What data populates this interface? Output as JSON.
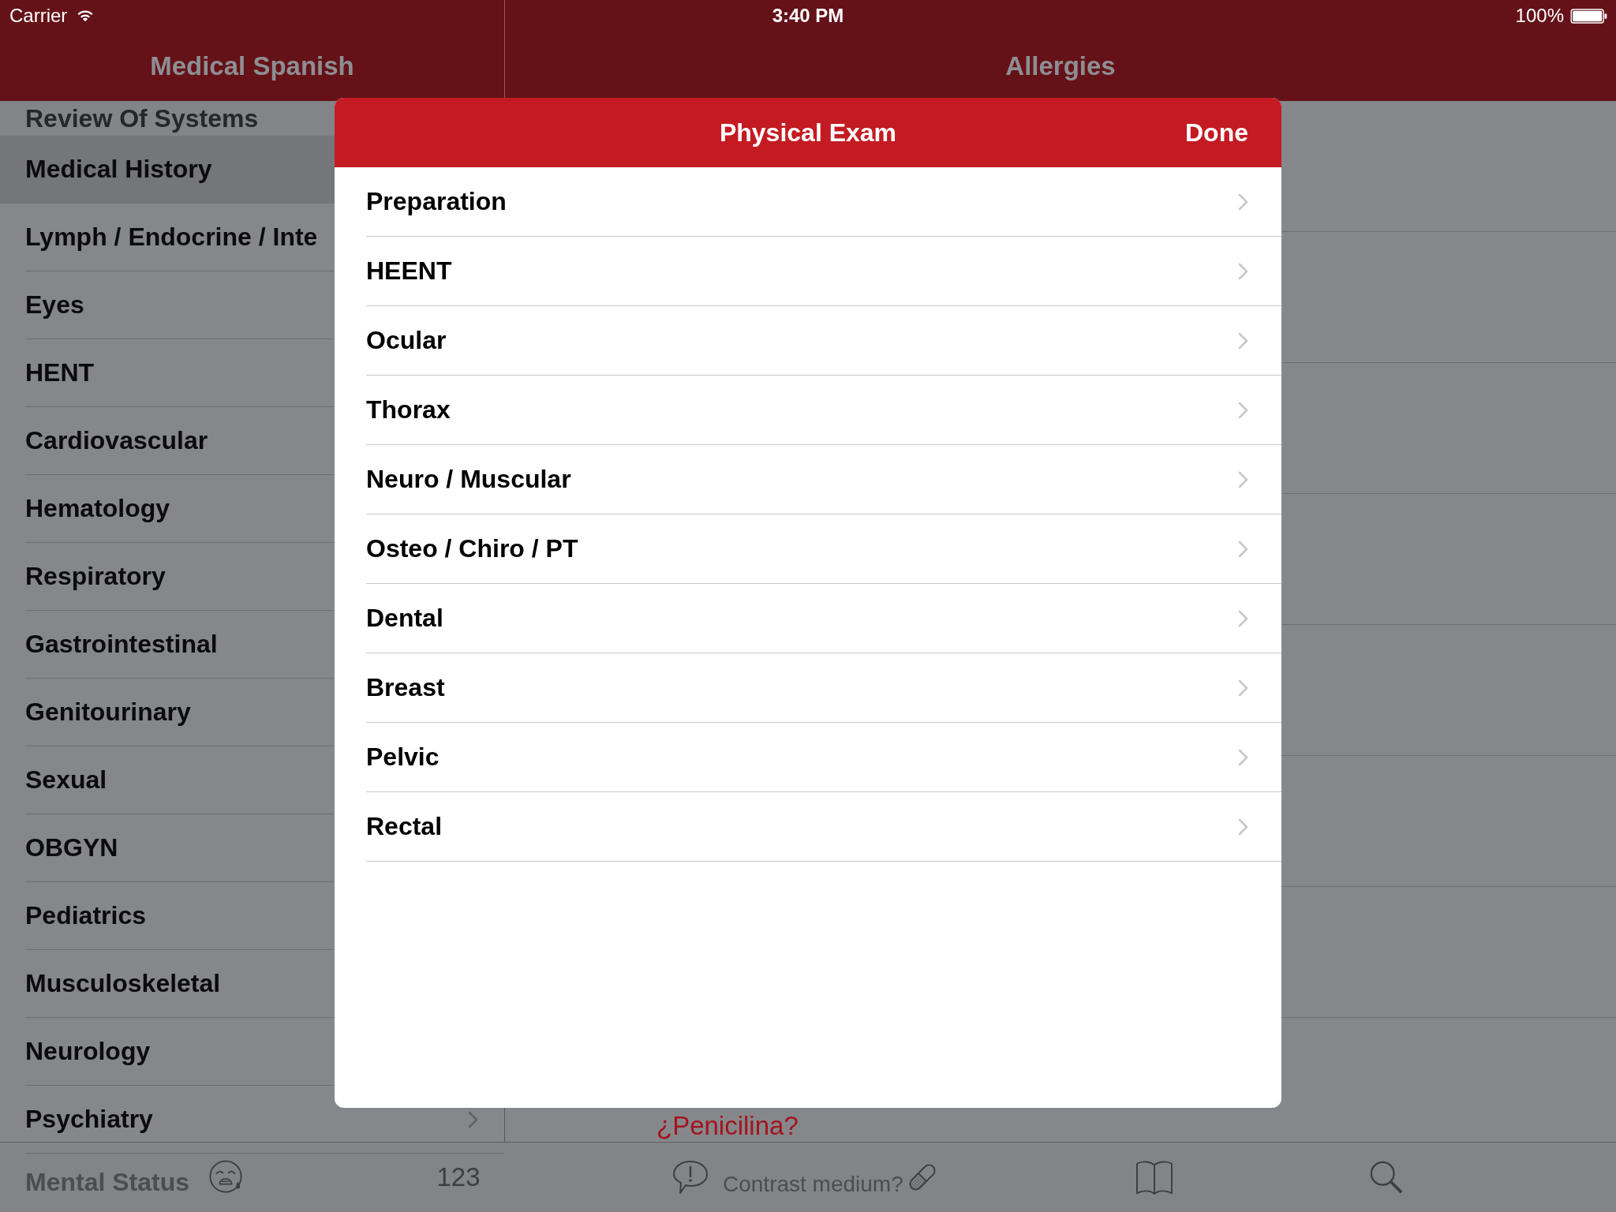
{
  "status_bar": {
    "carrier": "Carrier",
    "time": "3:40 PM",
    "battery": "100%"
  },
  "nav_bar": {
    "master_title": "Medical Spanish",
    "detail_title": "Allergies"
  },
  "sidebar": {
    "section": "Review Of Systems",
    "items": [
      {
        "label": "Medical History",
        "selected": true
      },
      {
        "label": "Lymph / Endocrine / Inte",
        "selected": false
      },
      {
        "label": "Eyes",
        "selected": false
      },
      {
        "label": "HENT",
        "selected": false
      },
      {
        "label": "Cardiovascular",
        "selected": false
      },
      {
        "label": "Hematology",
        "selected": false
      },
      {
        "label": "Respiratory",
        "selected": false
      },
      {
        "label": "Gastrointestinal",
        "selected": false
      },
      {
        "label": "Genitourinary",
        "selected": false
      },
      {
        "label": "Sexual",
        "selected": false
      },
      {
        "label": "OBGYN",
        "selected": false
      },
      {
        "label": "Pediatrics",
        "selected": false
      },
      {
        "label": "Musculoskeletal",
        "selected": false
      },
      {
        "label": "Neurology",
        "selected": false
      },
      {
        "label": "Psychiatry",
        "selected": false,
        "chevron": true
      },
      {
        "label": "Mental Status",
        "selected": false
      }
    ]
  },
  "detail": {
    "rows": [
      {
        "kind": "spanish",
        "text": "¿Penicilina?"
      },
      {
        "kind": "english",
        "text": "Contrast medium?"
      }
    ]
  },
  "modal": {
    "title": "Physical Exam",
    "done": "Done",
    "items": [
      {
        "label": "Preparation"
      },
      {
        "label": "HEENT"
      },
      {
        "label": "Ocular"
      },
      {
        "label": "Thorax"
      },
      {
        "label": "Neuro / Muscular"
      },
      {
        "label": "Osteo / Chiro / PT"
      },
      {
        "label": "Dental"
      },
      {
        "label": "Breast"
      },
      {
        "label": "Pelvic"
      },
      {
        "label": "Rectal"
      }
    ]
  },
  "tab_bar": {
    "items": [
      {
        "kind": "icon",
        "selected": false
      },
      {
        "kind": "text",
        "label": "123",
        "selected": false
      },
      {
        "kind": "icon",
        "selected": false
      },
      {
        "kind": "icon",
        "selected": false
      },
      {
        "kind": "icon",
        "selected": false
      },
      {
        "kind": "icon",
        "selected": false
      }
    ]
  }
}
